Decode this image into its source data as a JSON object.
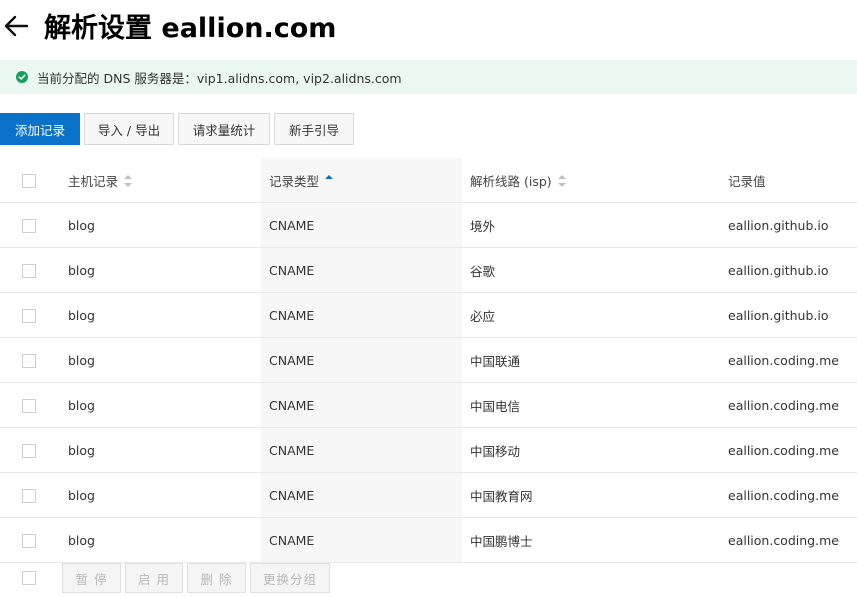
{
  "header": {
    "title": "解析设置 eallion.com"
  },
  "notice": {
    "text": "当前分配的 DNS 服务器是：vip1.alidns.com, vip2.alidns.com",
    "color": "#14a05a"
  },
  "toolbar": {
    "add_label": "添加记录",
    "import_export_label": "导入 / 导出",
    "stats_label": "请求量统计",
    "guide_label": "新手引导"
  },
  "table": {
    "headers": {
      "host": "主机记录",
      "type": "记录类型",
      "line": "解析线路 (isp)",
      "value": "记录值"
    },
    "rows": [
      {
        "host": "blog",
        "type": "CNAME",
        "line": "境外",
        "value": "eallion.github.io"
      },
      {
        "host": "blog",
        "type": "CNAME",
        "line": "谷歌",
        "value": "eallion.github.io"
      },
      {
        "host": "blog",
        "type": "CNAME",
        "line": "必应",
        "value": "eallion.github.io"
      },
      {
        "host": "blog",
        "type": "CNAME",
        "line": "中国联通",
        "value": "eallion.coding.me"
      },
      {
        "host": "blog",
        "type": "CNAME",
        "line": "中国电信",
        "value": "eallion.coding.me"
      },
      {
        "host": "blog",
        "type": "CNAME",
        "line": "中国移动",
        "value": "eallion.coding.me"
      },
      {
        "host": "blog",
        "type": "CNAME",
        "line": "中国教育网",
        "value": "eallion.coding.me"
      },
      {
        "host": "blog",
        "type": "CNAME",
        "line": "中国鹏博士",
        "value": "eallion.coding.me"
      }
    ]
  },
  "footer": {
    "pause_label": "暂 停",
    "enable_label": "启 用",
    "delete_label": "删 除",
    "regroup_label": "更换分组"
  },
  "colors": {
    "accent": "#0a72c8",
    "notice_bg": "#ebf8f2"
  },
  "icons": {
    "back": "arrow-left-icon",
    "status": "check-circle-icon"
  }
}
